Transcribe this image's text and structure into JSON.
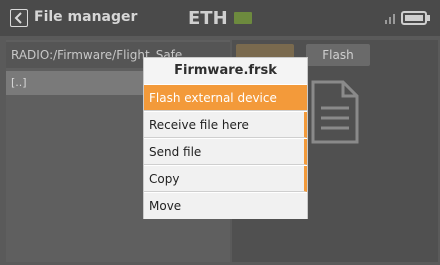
{
  "header": {
    "title": "File manager",
    "logo_text": "ETH"
  },
  "file_manager": {
    "path": "RADIO:/Firmware/Flight_Safe",
    "entries": [
      "[..]"
    ],
    "flash_label": "Flash"
  },
  "popup": {
    "title": "Firmware.frsk",
    "items": [
      {
        "label": "Flash external device",
        "selected": true
      },
      {
        "label": "Receive file here",
        "selected": false
      },
      {
        "label": "Send file",
        "selected": false
      },
      {
        "label": "Copy",
        "selected": false
      },
      {
        "label": "Move",
        "selected": false
      }
    ]
  },
  "colors": {
    "accent": "#f39a3a",
    "overlay": "#5a5a5a"
  }
}
